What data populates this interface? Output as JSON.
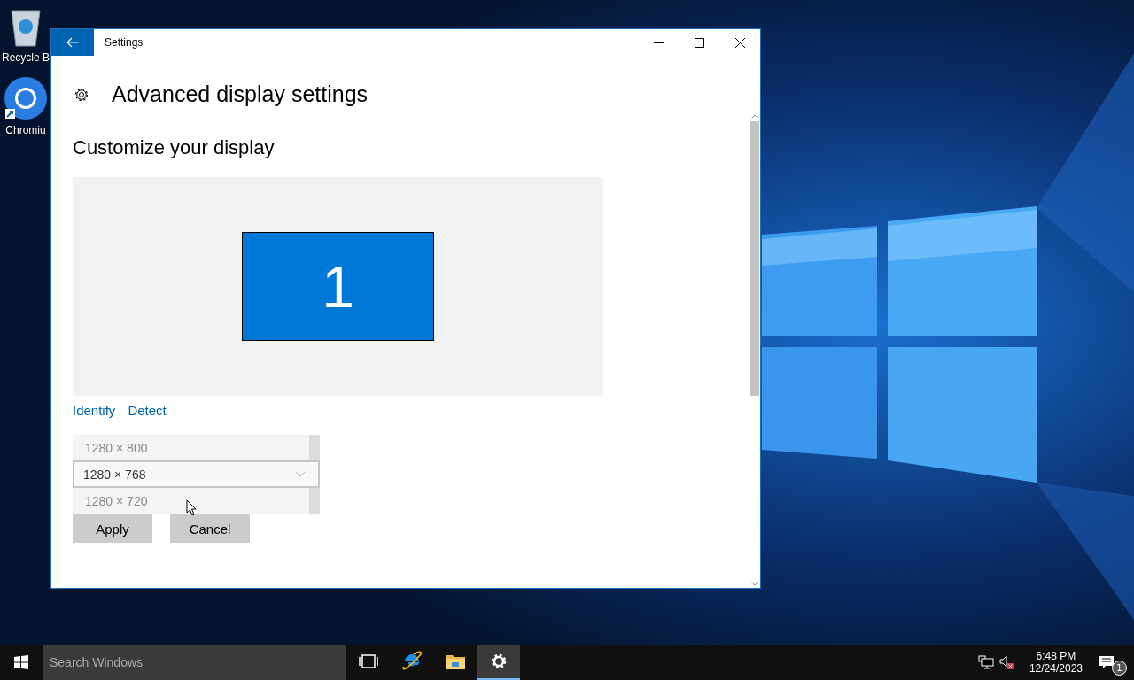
{
  "desktop": {
    "icons": [
      {
        "kind": "recycle-bin",
        "label": "Recycle B"
      },
      {
        "kind": "chromium",
        "label": "Chromiu"
      }
    ]
  },
  "window": {
    "title": "Settings",
    "heading": "Advanced display settings",
    "section": "Customize your display",
    "monitor": "1",
    "links": [
      "Identify",
      "Detect"
    ],
    "resolution_options": [
      {
        "label": "1280 × 800",
        "selected": false
      },
      {
        "label": "1280 × 768",
        "selected": true
      },
      {
        "label": "1280 × 720",
        "selected": false
      }
    ],
    "buttons": [
      "Apply",
      "Cancel"
    ]
  },
  "taskbar": {
    "search": {
      "placeholder": "Search Windows"
    },
    "apps": [
      {
        "kind": "task-view",
        "selected": false
      },
      {
        "kind": "browser",
        "selected": false
      },
      {
        "kind": "folder",
        "selected": false
      },
      {
        "kind": "settings",
        "selected": true
      }
    ],
    "clock": {
      "time": "6:48 PM",
      "date": "12/24/2023"
    },
    "notifications": {
      "count": "1"
    }
  }
}
